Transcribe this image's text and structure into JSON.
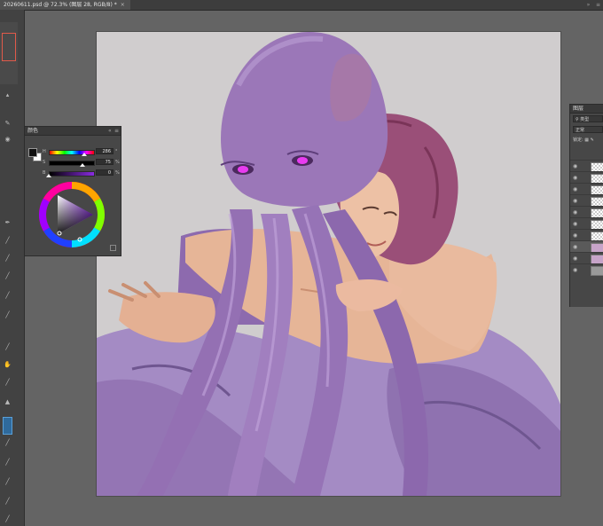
{
  "document": {
    "tab_title": "20260611.psd @ 72.3% (图层 28, RGB/8) *",
    "close_glyph": "×"
  },
  "toolbar": {
    "tools": [
      "brush-icon",
      "eraser-icon",
      "pen-icon",
      "smudge-icon",
      "dodge-icon",
      "lasso-icon",
      "move-icon",
      "eyedropper-icon",
      "text-icon",
      "hand-icon",
      "zoom-icon",
      "color-swatch-icon"
    ],
    "active_tool": "color-swatch-icon"
  },
  "color_panel": {
    "title": "颜色",
    "collapse_glyph": "«",
    "menu_glyph": "≡",
    "sliders": [
      {
        "label": "H",
        "value": "286",
        "unit": "°",
        "fraction": 0.79
      },
      {
        "label": "S",
        "value": "75",
        "unit": "%",
        "fraction": 0.75
      },
      {
        "label": "B",
        "value": "0",
        "unit": "%",
        "fraction": 0.0
      }
    ],
    "foreground_color": "#111111",
    "background_color": "#ffffff",
    "wheel_hue": "#8a2be2"
  },
  "layers_panel": {
    "title": "图层",
    "search_placeholder": "类型",
    "blend_mode": "正常",
    "lock_label": "锁定:",
    "layers": [
      {
        "thumb": "transparent",
        "visible": true
      },
      {
        "thumb": "transparent",
        "visible": true
      },
      {
        "thumb": "transparent",
        "visible": true
      },
      {
        "thumb": "transparent",
        "visible": true
      },
      {
        "thumb": "transparent",
        "visible": true
      },
      {
        "thumb": "transparent",
        "visible": true
      },
      {
        "thumb": "transparent",
        "visible": true
      },
      {
        "thumb": "image",
        "visible": true
      },
      {
        "thumb": "image",
        "visible": true
      },
      {
        "thumb": "gray",
        "visible": true
      }
    ]
  },
  "colors": {
    "canvas_bg": "#d0cdce",
    "creature_skin": "#9b77b8",
    "creature_shadow": "#7a5a98",
    "hair": "#9a4f78",
    "skin": "#e8b89b",
    "cloth": "#a58ac2",
    "eye_glow": "#e83cf0"
  }
}
